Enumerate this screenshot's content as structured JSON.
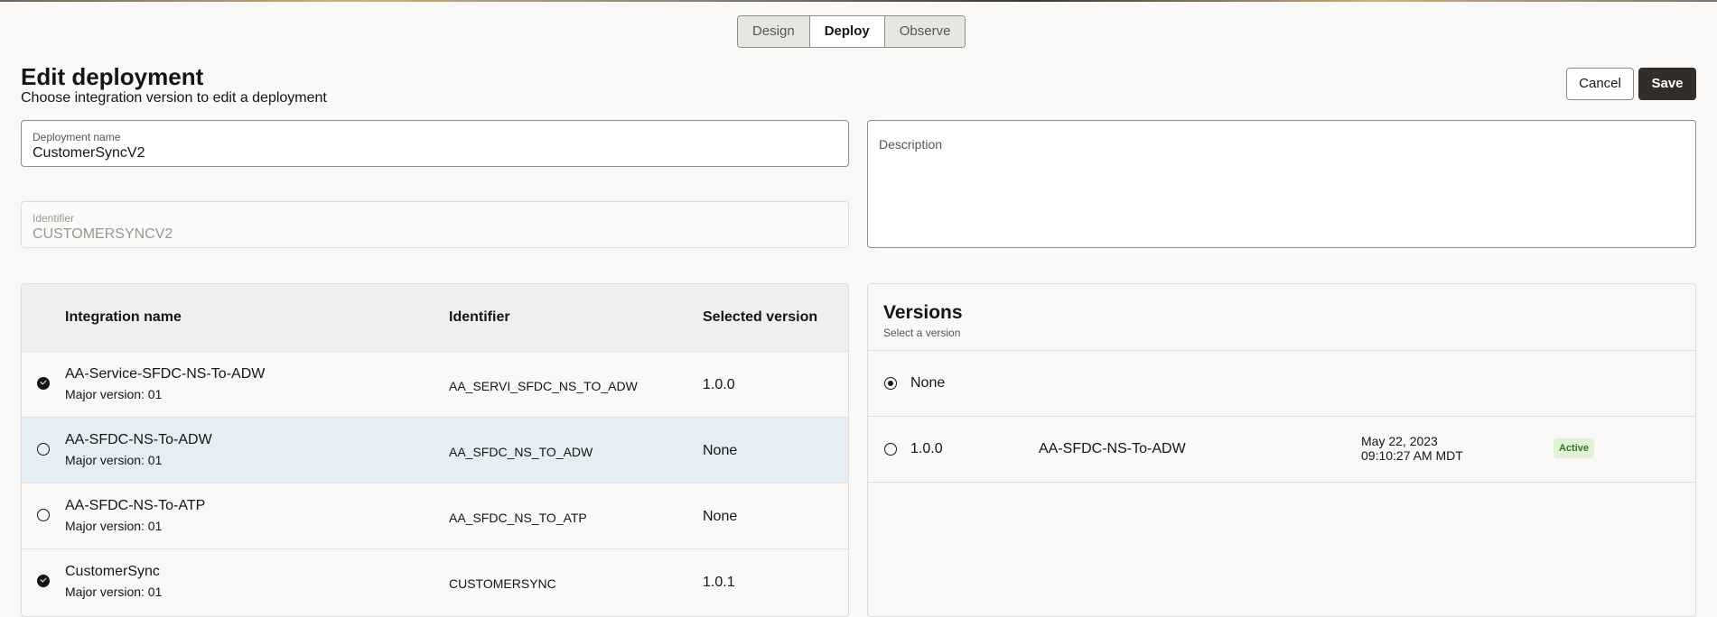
{
  "tabs": [
    "Design",
    "Deploy",
    "Observe"
  ],
  "header": {
    "title": "Edit deployment",
    "subtitle": "Choose integration version to edit a deployment",
    "cancel": "Cancel",
    "save": "Save"
  },
  "form": {
    "name_label": "Deployment name",
    "name_value": "CustomerSyncV2",
    "id_label": "Identifier",
    "id_value": "CUSTOMERSYNCV2",
    "desc_label": "Description"
  },
  "table": {
    "headers": [
      "Integration name",
      "Identifier",
      "Selected version"
    ],
    "rows": [
      {
        "name": "AA-Service-SFDC-NS-To-ADW",
        "sub": "Major version: 01",
        "id": "AA_SERVI_SFDC_NS_TO_ADW",
        "version": "1.0.0",
        "checked": true
      },
      {
        "name": "AA-SFDC-NS-To-ADW",
        "sub": "Major version: 01",
        "id": "AA_SFDC_NS_TO_ADW",
        "version": "None",
        "checked": false
      },
      {
        "name": "AA-SFDC-NS-To-ATP",
        "sub": "Major version: 01",
        "id": "AA_SFDC_NS_TO_ATP",
        "version": "None",
        "checked": false
      },
      {
        "name": "CustomerSync",
        "sub": "Major version: 01",
        "id": "CUSTOMERSYNC",
        "version": "1.0.1",
        "checked": true
      }
    ]
  },
  "versions": {
    "title": "Versions",
    "subtitle": "Select a version",
    "none": "None",
    "items": [
      {
        "version": "1.0.0",
        "name": "AA-SFDC-NS-To-ADW",
        "date": "May 22, 2023",
        "time": "09:10:27 AM MDT",
        "status": "Active"
      }
    ]
  }
}
